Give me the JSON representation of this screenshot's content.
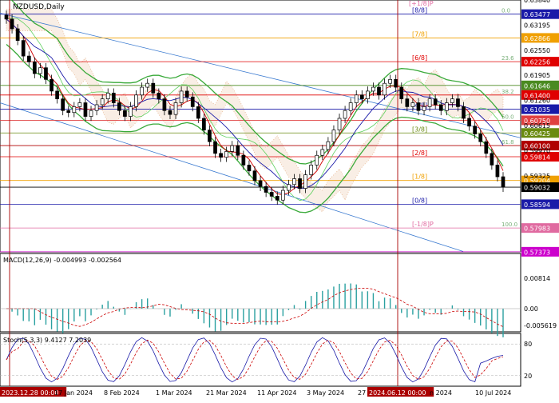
{
  "chart_data": {
    "type": "candlestick",
    "symbol_label": "NZDUSD,Daily",
    "timeframe": "Daily",
    "price_ylim": [
      0.5737,
      0.6384
    ],
    "price_axis_ticks": [
      "0.63840",
      "0.63195",
      "0.62550",
      "0.61905",
      "0.61260",
      "0.60615",
      "0.59970",
      "0.59325"
    ],
    "levels": [
      {
        "value": 0.63477,
        "label": "0.63477",
        "murrey": "[8/8]",
        "fib": "0.0",
        "color": "#1a1aa8"
      },
      {
        "value": 0.62866,
        "label": "0.62866",
        "murrey": "[7/8]",
        "fib": "",
        "color": "#f0a000"
      },
      {
        "value": 0.62256,
        "label": "0.62256",
        "murrey": "[6/8]",
        "fib": "23.6",
        "color": "#e00000"
      },
      {
        "value": 0.61646,
        "label": "0.61646",
        "murrey": "",
        "fib": "",
        "color": "#4a8a20"
      },
      {
        "value": 0.614,
        "label": "0.61400",
        "murrey": "",
        "fib": "38.2",
        "color": "#e00000"
      },
      {
        "value": 0.61035,
        "label": "0.61035",
        "murrey": "[4/8]",
        "fib": "",
        "color": "#1a1aa8"
      },
      {
        "value": 0.6075,
        "label": "0.60750",
        "murrey": "",
        "fib": "50.0",
        "color": "#e04040"
      },
      {
        "value": 0.60425,
        "label": "0.60425",
        "murrey": "[3/8]",
        "fib": "",
        "color": "#6a8a10"
      },
      {
        "value": 0.601,
        "label": "0.60100",
        "murrey": "",
        "fib": "61.8",
        "color": "#b00000"
      },
      {
        "value": 0.59814,
        "label": "0.59814",
        "murrey": "[2/8]",
        "fib": "",
        "color": "#e00000"
      },
      {
        "value": 0.59204,
        "label": "0.59204",
        "murrey": "[1/8]",
        "fib": "",
        "color": "#f0a000"
      },
      {
        "value": 0.59032,
        "label": "0.59032",
        "murrey": "",
        "fib": "",
        "color": "#000000"
      },
      {
        "value": 0.58594,
        "label": "0.58594",
        "murrey": "[0/8]",
        "fib": "",
        "color": "#1a1aa8"
      },
      {
        "value": 0.57983,
        "label": "0.57983",
        "murrey": "[-1/8]P",
        "fib": "100.0",
        "color": "#e06aa0"
      },
      {
        "value": 0.57373,
        "label": "0.57373",
        "murrey": "",
        "fib": "",
        "color": "#cc00cc"
      }
    ],
    "top_label": "[+1/8]P",
    "macd_label": "MACD(12,26,9) -0.004993 -0.002564",
    "macd_ticks": [
      "0.00814",
      "0.00",
      "-0.005619"
    ],
    "stoch_label": "Stoch(5,3,3) 9.4127 7.2039",
    "stoch_ticks": [
      "80",
      "20"
    ],
    "x_tick_labels": [
      "2023.12.28 00:00",
      "17 Jan 2024",
      "8 Feb 2024",
      "1 Mar 2024",
      "21 Mar 2024",
      "11 Apr 2024",
      "3 May 2024",
      "27 May 2024",
      "2024.06.12 00:00",
      "n 2024",
      "10 Jul 2024"
    ],
    "x_highlight_labels": [
      "2023.12.28 00:00",
      "2024.06.12 00:00"
    ],
    "closes": [
      0.6335,
      0.631,
      0.628,
      0.624,
      0.6225,
      0.6195,
      0.621,
      0.618,
      0.615,
      0.613,
      0.61,
      0.6095,
      0.611,
      0.612,
      0.6085,
      0.61,
      0.6115,
      0.613,
      0.6145,
      0.612,
      0.61,
      0.6085,
      0.611,
      0.614,
      0.616,
      0.617,
      0.6145,
      0.613,
      0.61,
      0.609,
      0.612,
      0.615,
      0.6135,
      0.611,
      0.608,
      0.605,
      0.602,
      0.599,
      0.598,
      0.5995,
      0.601,
      0.5985,
      0.596,
      0.5945,
      0.592,
      0.5905,
      0.589,
      0.588,
      0.587,
      0.5895,
      0.591,
      0.5925,
      0.59,
      0.5935,
      0.596,
      0.5985,
      0.6,
      0.602,
      0.605,
      0.608,
      0.61,
      0.612,
      0.614,
      0.613,
      0.615,
      0.616,
      0.614,
      0.617,
      0.618,
      0.616,
      0.613,
      0.611,
      0.612,
      0.61,
      0.611,
      0.613,
      0.6115,
      0.61,
      0.612,
      0.613,
      0.611,
      0.608,
      0.606,
      0.604,
      0.602,
      0.599,
      0.596,
      0.593,
      0.5903
    ]
  },
  "colors": {
    "candle": "#000000",
    "bollinger": "#3aaa3a",
    "envelope": "#5cd05c",
    "ma_fast": "#d00000",
    "ma_slow": "#1a1aa8",
    "ichimoku_cloud": "#e0a070",
    "trend_channel": "#3a7ad0",
    "macd_hist": "#2aa0a0",
    "macd_signal": "#cc0000",
    "stoch_main": "#1a1aa8",
    "stoch_signal": "#cc0000",
    "highlight_vline": "#aa0000"
  }
}
